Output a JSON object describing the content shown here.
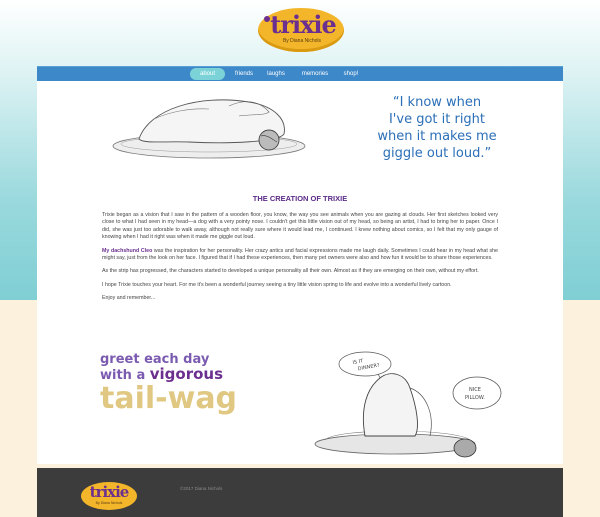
{
  "header": {
    "logo_text": "trixie",
    "logo_sub": "By Diana Nichols"
  },
  "nav": {
    "items": [
      {
        "label": "about",
        "active": true
      },
      {
        "label": "friends",
        "active": false
      },
      {
        "label": "laughs",
        "active": false
      },
      {
        "label": "memories",
        "active": false
      },
      {
        "label": "shop!",
        "active": false
      }
    ]
  },
  "hero": {
    "quote_lines": [
      "“I know when",
      "I've got it right",
      "when it makes me",
      "giggle out loud.”"
    ]
  },
  "article": {
    "title": "THE CREATION OF TRIXIE",
    "p1": "Trixie began as a vision that I saw in the pattern of a wooden floor, you know, the way you see animals when you are gazing at clouds. Her first sketches looked very close to what I had seen in my head—a dog with a very pointy nose. I couldn't get this little vision out of my head, so being an artist, I had to bring her to paper. Once I did, she was just too adorable to walk away, although not really sure where it would lead me, I continued. I knew nothing about comics, so I felt that my only gauge of knowing when I had it right was when it made me giggle out loud.",
    "p2_highlight": "My dachshund Cleo",
    "p2_rest": " was the inspiration for her personality. Her crazy antics and facial expressions made me laugh daily. Sometimes I could hear in my head what she might say, just from the look on her face. I figured that if I had these experiences, then many pet owners were also and how fun it would be to share those experiences.",
    "p3": "As the strip has progressed, the characters started to developed a unique personality all their own. Almost as if they are emerging on their own, without my effort.",
    "p4": "I hope Trixie touches your heart. For me it's been a wonderful journey seeing a tiny little vision spring to life and evolve into a wonderful lively cartoon.",
    "p5": "Enjoy and remember..."
  },
  "greeting": {
    "line1": "greet each day",
    "line2_a": "with a ",
    "line2_b": "vigorous",
    "line3": "tail-wag"
  },
  "sketch2": {
    "bubble1_l1": "IS IT",
    "bubble1_l2": "DINNER?",
    "bubble2_l1": "NICE",
    "bubble2_l2": "PILLOW."
  },
  "footer": {
    "logo_text": "trixie",
    "logo_sub": "By Diana Nichols",
    "copyright": "©2017 Diana Nichols"
  },
  "colors": {
    "nav": "#3d88c8",
    "nav_active": "#7bd3d7",
    "title": "#5b2a86",
    "quote": "#2b6fb8",
    "logo": "#f3b62a",
    "footer": "#3c3c3c"
  }
}
